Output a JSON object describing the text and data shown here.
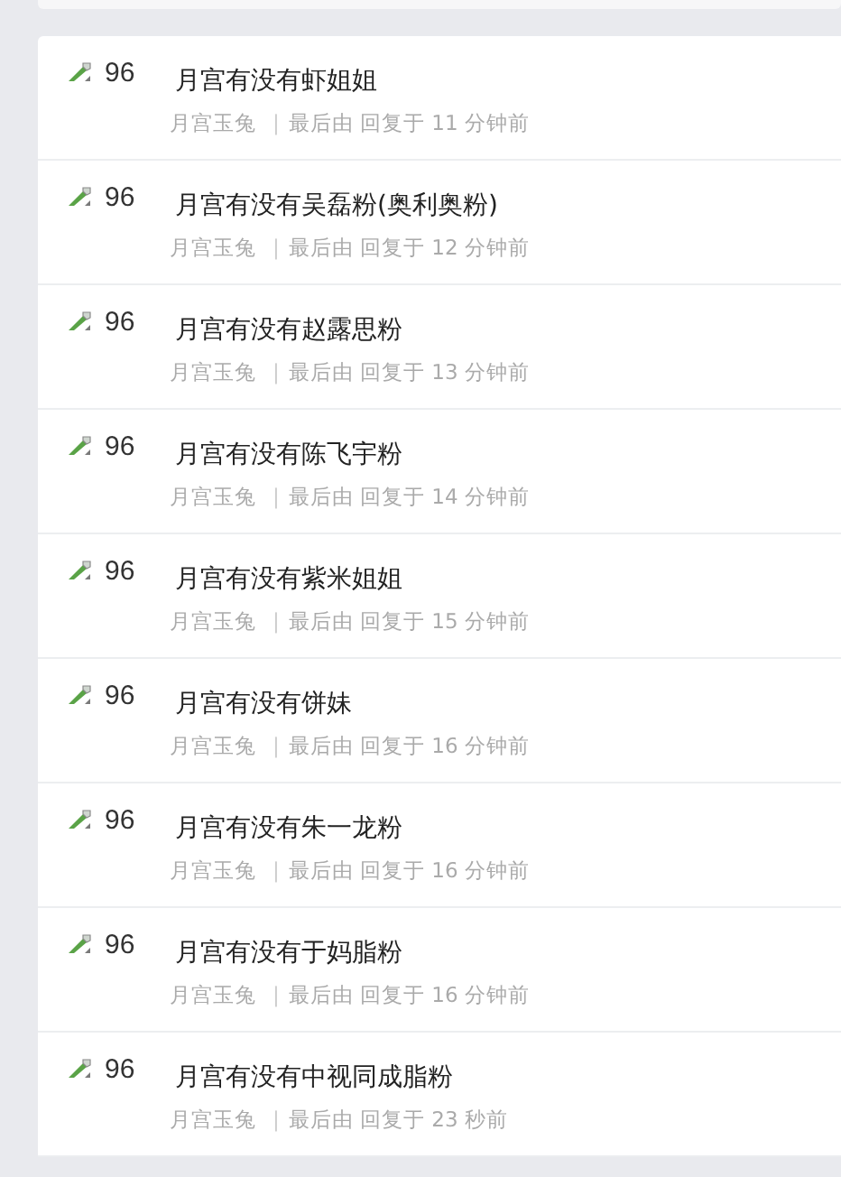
{
  "topics": [
    {
      "count": "96",
      "title": "月宫有没有虾姐姐",
      "author": "月宫玉兔",
      "separator": "|",
      "reply": "最后由 回复于 11 分钟前"
    },
    {
      "count": "96",
      "title": "月宫有没有吴磊粉(奥利奥粉)",
      "author": "月宫玉兔",
      "separator": "|",
      "reply": "最后由 回复于 12 分钟前"
    },
    {
      "count": "96",
      "title": "月宫有没有赵露思粉",
      "author": "月宫玉兔",
      "separator": "|",
      "reply": "最后由 回复于 13 分钟前"
    },
    {
      "count": "96",
      "title": "月宫有没有陈飞宇粉",
      "author": "月宫玉兔",
      "separator": "|",
      "reply": "最后由 回复于 14 分钟前"
    },
    {
      "count": "96",
      "title": "月宫有没有紫米姐姐",
      "author": "月宫玉兔",
      "separator": "|",
      "reply": "最后由 回复于 15 分钟前"
    },
    {
      "count": "96",
      "title": "月宫有没有饼妹",
      "author": "月宫玉兔",
      "separator": "|",
      "reply": "最后由 回复于 16 分钟前"
    },
    {
      "count": "96",
      "title": "月宫有没有朱一龙粉",
      "author": "月宫玉兔",
      "separator": "|",
      "reply": "最后由 回复于 16 分钟前"
    },
    {
      "count": "96",
      "title": "月宫有没有于妈脂粉",
      "author": "月宫玉兔",
      "separator": "|",
      "reply": "最后由 回复于 16 分钟前"
    },
    {
      "count": "96",
      "title": "月宫有没有中视同成脂粉",
      "author": "月宫玉兔",
      "separator": "|",
      "reply": "最后由 回复于 23 秒前"
    }
  ]
}
